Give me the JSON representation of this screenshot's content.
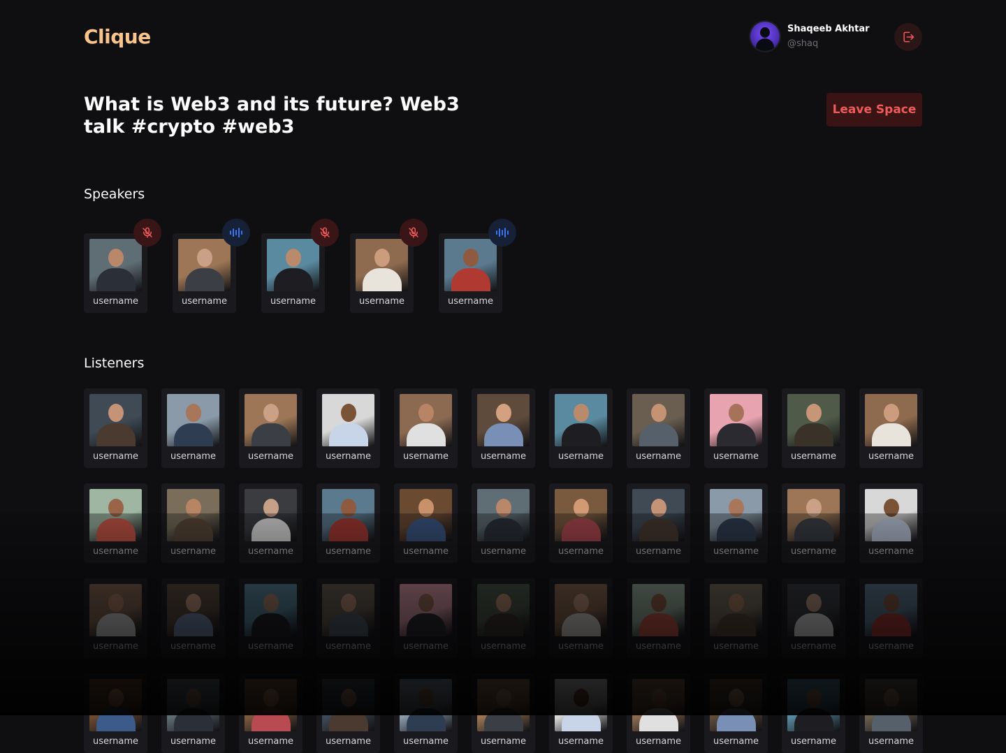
{
  "app": {
    "name": "Clique"
  },
  "user": {
    "name": "Shaqeeb Akhtar",
    "handle": "@shaq"
  },
  "space": {
    "title": "What is Web3 and its future? Web3 talk #crypto #web3",
    "leave_label": "Leave Space"
  },
  "sections": {
    "speakers": "Speakers",
    "listeners": "Listeners"
  },
  "colors": {
    "accent": "#f8c48c",
    "danger": "#ef5a5a",
    "talking": "#3b73f0",
    "background": "#0f0f11",
    "card": "#1a1a1e"
  },
  "speakers": [
    {
      "username": "username",
      "status": "muted"
    },
    {
      "username": "username",
      "status": "talking"
    },
    {
      "username": "username",
      "status": "muted"
    },
    {
      "username": "username",
      "status": "muted"
    },
    {
      "username": "username",
      "status": "talking"
    }
  ],
  "listeners": [
    "username",
    "username",
    "username",
    "username",
    "username",
    "username",
    "username",
    "username",
    "username",
    "username",
    "username",
    "username",
    "username",
    "username",
    "username",
    "username",
    "username",
    "username",
    "username",
    "username",
    "username",
    "username",
    "username",
    "username",
    "username",
    "username",
    "username",
    "username",
    "username",
    "username",
    "username",
    "username",
    "username",
    "username",
    "username",
    "username",
    "username",
    "username",
    "username",
    "username",
    "username",
    "username",
    "username",
    "username"
  ]
}
